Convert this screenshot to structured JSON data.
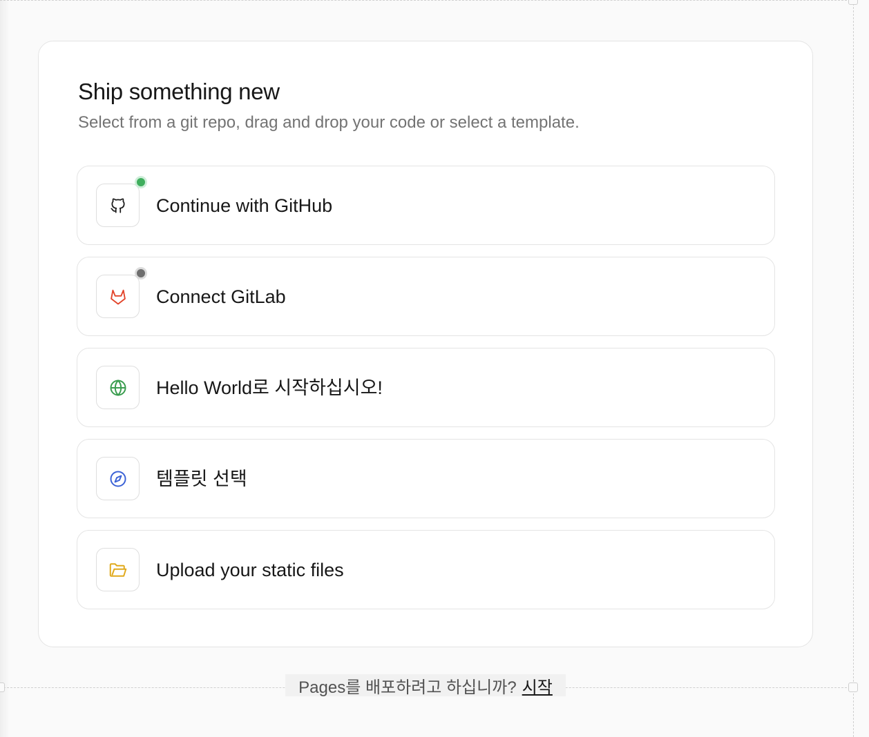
{
  "card": {
    "title": "Ship something new",
    "subtitle": "Select from a git repo, drag and drop your code or select a template."
  },
  "options": [
    {
      "label": "Continue with GitHub",
      "icon": "github-icon",
      "status": "connected",
      "status_color": "#3fae5d"
    },
    {
      "label": "Connect GitLab",
      "icon": "gitlab-icon",
      "status": "not-connected",
      "status_color": "#6e6e6e"
    },
    {
      "label": "Hello World로 시작하십시오!",
      "icon": "globe-icon",
      "icon_color": "#3a9d4f"
    },
    {
      "label": "템플릿 선택",
      "icon": "compass-icon",
      "icon_color": "#3b62d6"
    },
    {
      "label": "Upload your static files",
      "icon": "folder-icon",
      "icon_color": "#e0a91c"
    }
  ],
  "footer": {
    "text": "Pages를 배포하려고 하십니까?",
    "link_label": "시작"
  }
}
